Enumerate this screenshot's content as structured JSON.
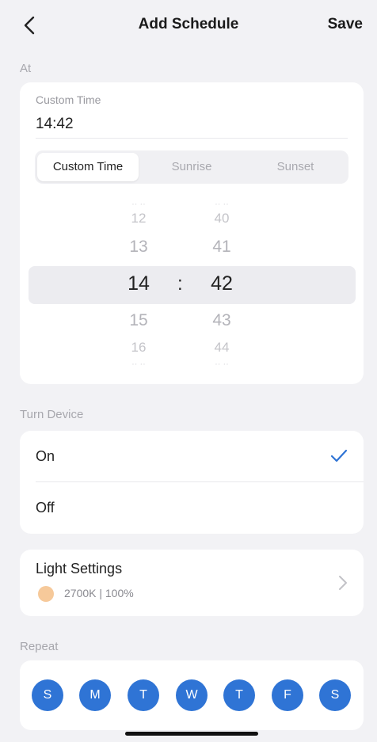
{
  "header": {
    "title": "Add Schedule",
    "save_label": "Save"
  },
  "at": {
    "label": "At",
    "custom_time_label": "Custom Time",
    "custom_time_value": "14:42",
    "segments": [
      "Custom Time",
      "Sunrise",
      "Sunset"
    ],
    "active_segment": "Custom Time",
    "hours": [
      "12",
      "13",
      "14",
      "15",
      "16"
    ],
    "minutes": [
      "40",
      "41",
      "42",
      "43",
      "44"
    ],
    "separator": ":"
  },
  "turn_device": {
    "label": "Turn Device",
    "options": [
      {
        "label": "On",
        "selected": true
      },
      {
        "label": "Off",
        "selected": false
      }
    ]
  },
  "light_settings": {
    "title": "Light Settings",
    "value": "2700K | 100%",
    "swatch_color": "#f6c99a"
  },
  "repeat": {
    "label": "Repeat",
    "days": [
      "S",
      "M",
      "T",
      "W",
      "T",
      "F",
      "S"
    ]
  },
  "colors": {
    "accent": "#2f74d5",
    "background": "#f2f2f5"
  }
}
